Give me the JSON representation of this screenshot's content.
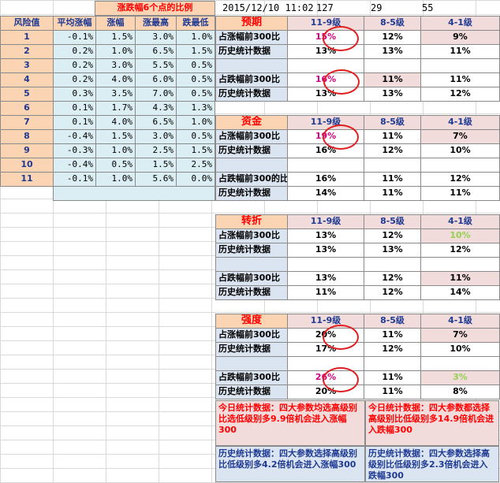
{
  "top_bar": {
    "timestamp": "2015/12/10 11:02",
    "v1": "127",
    "v2": "29",
    "v3": "55"
  },
  "left_table": {
    "banner": "涨跌幅6个点的比例",
    "headers": [
      "风险值",
      "平均涨幅",
      "涨幅",
      "涨最高",
      "跌最低"
    ],
    "rows": [
      [
        "1",
        "-0.1%",
        "1.5%",
        "3.0%",
        "1.0%"
      ],
      [
        "2",
        "0.2%",
        "1.0%",
        "6.5%",
        "1.5%"
      ],
      [
        "3",
        "0.2%",
        "3.0%",
        "5.5%",
        "0.5%"
      ],
      [
        "4",
        "0.2%",
        "4.0%",
        "6.0%",
        "0.5%"
      ],
      [
        "5",
        "0.3%",
        "3.5%",
        "7.0%",
        "0.5%"
      ],
      [
        "6",
        "0.1%",
        "1.7%",
        "4.3%",
        "1.3%"
      ],
      [
        "7",
        "0.1%",
        "4.0%",
        "6.5%",
        "1.0%"
      ],
      [
        "8",
        "-0.4%",
        "1.5%",
        "3.0%",
        "0.5%"
      ],
      [
        "9",
        "-0.3%",
        "1.0%",
        "2.5%",
        "1.5%"
      ],
      [
        "10",
        "-0.4%",
        "0.5%",
        "1.5%",
        "2.5%"
      ],
      [
        "11",
        "-0.1%",
        "1.0%",
        "5.6%",
        "0.0%"
      ]
    ]
  },
  "cols": [
    "11-9级",
    "8-5级",
    "4-1级"
  ],
  "sections": {
    "yuqi": {
      "title": "预期",
      "rows": [
        [
          "占涨幅前300比",
          "15%",
          "12%",
          "9%"
        ],
        [
          "历史统计数据",
          "13%",
          "13%",
          "11%"
        ],
        [
          "占跌幅前300比",
          "16%",
          "11%",
          "11%"
        ],
        [
          "历史统计数据",
          "13%",
          "13%",
          "12%"
        ]
      ]
    },
    "zijin": {
      "title": "资金",
      "rows": [
        [
          "占涨幅前300比",
          "19%",
          "11%",
          "7%"
        ],
        [
          "历史统计数据",
          "16%",
          "12%",
          "10%"
        ],
        [
          "占跌幅前300的比",
          "16%",
          "11%",
          "12%"
        ],
        [
          "历史统计数据",
          "14%",
          "11%",
          "11%"
        ]
      ]
    },
    "zhuanzhe": {
      "title": "转折",
      "rows": [
        [
          "占涨幅前300比",
          "13%",
          "12%",
          "10%"
        ],
        [
          "历史统计数据",
          "13%",
          "13%",
          "12%"
        ],
        [
          "占跌幅前300比",
          "13%",
          "12%",
          "11%"
        ],
        [
          "历史统计数据",
          "11%",
          "12%",
          "14%"
        ]
      ]
    },
    "qiangdu": {
      "title": "强度",
      "rows": [
        [
          "占涨幅前300比",
          "20%",
          "11%",
          "7%"
        ],
        [
          "历史统计数据",
          "17%",
          "12%",
          "10%"
        ],
        [
          "占跌幅前300比",
          "26%",
          "11%",
          "3%"
        ],
        [
          "历史统计数据",
          "20%",
          "11%",
          "8%"
        ]
      ]
    }
  },
  "notes": {
    "today_left": "今日统计数据：四大参数均选高级别比选低级别多9.9倍机会进入涨幅300",
    "today_right": "今日统计数据：四大参数都选择高级别比低级别多14.9倍机会进入跌幅300",
    "hist_left": "历史统计数据：四大参数选择高级别比低级别多4.2倍机会进入涨幅300",
    "hist_right": "历史统计数据：四大参数选择高级别比低级别多2.3倍机会进入跌幅300"
  }
}
